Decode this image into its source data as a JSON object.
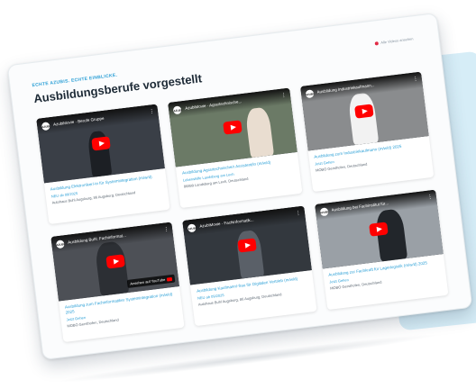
{
  "section": {
    "kicker": "ECHTE AZUBIS. ECHTE EINBLICKE.",
    "heading": "Ausbildungsberufe vorgestellt",
    "show_all": "Alle Videos ansehen"
  },
  "videos": [
    {
      "channel": "AZUBI",
      "thumb_title": "AzubiMovie · Berufe Gruppe",
      "title": "Ausbildung Elektroniker/-in für Systemintegration (m/w/d)",
      "sub": "NEU ab 09/2025",
      "company": "Autohaus Buhl Augsburg, 86 Augsburg, Deutschland",
      "bg": "#3a3f47",
      "badge": ""
    },
    {
      "channel": "AZUBI",
      "thumb_title": "AzubiMovie · Agrartechnische...",
      "title": "Ausbildung Agrartechnische/r Assistent/in (m/w/d)",
      "sub": "Lebenshilfe Landsberg am Lech",
      "company": "86899 Landsberg am Lech, Deutschland",
      "bg": "#6b7a66",
      "badge": ""
    },
    {
      "channel": "AZUBI",
      "thumb_title": "Ausbildung Industriekaufmann...",
      "title": "Ausbildung zum Industriekaufmann (m/w/d) 2025",
      "sub": "Jetzt Gehen",
      "company": "MOBO Gersthofen, Deutschland",
      "bg": "#8a8c8e",
      "badge": ""
    },
    {
      "channel": "AZUBI",
      "thumb_title": "Ausbildung Buhl: Fachinformat...",
      "title": "Ausbildung zum Fachinformatiker Systemintegration (m/w/d) 2025",
      "sub": "Jetzt Gehen",
      "company": "MOBO Gersthofen, Deutschland",
      "bg": "#4d5056",
      "badge": "Ansehen auf YouTube"
    },
    {
      "channel": "AZUBI",
      "thumb_title": "AzubiMovie · Fachinformatik...",
      "title": "Ausbildung Kaufmann/-frau für Digitalen Vertrieb (m/w/d)",
      "sub": "NEU ab 09/2025",
      "company": "Autohaus Buhl Augsburg, 86 Augsburg, Deutschland",
      "bg": "#33383e",
      "badge": ""
    },
    {
      "channel": "AZUBI",
      "thumb_title": "Ausbildung bei Fachinstitut für...",
      "title": "Ausbildung zur Fachkraft für Lagerlogistik (m/w/d) 2025",
      "sub": "Jetzt Gehen",
      "company": "MOBO Gersthofen, Deutschland",
      "bg": "#9aa0a6",
      "badge": ""
    }
  ]
}
